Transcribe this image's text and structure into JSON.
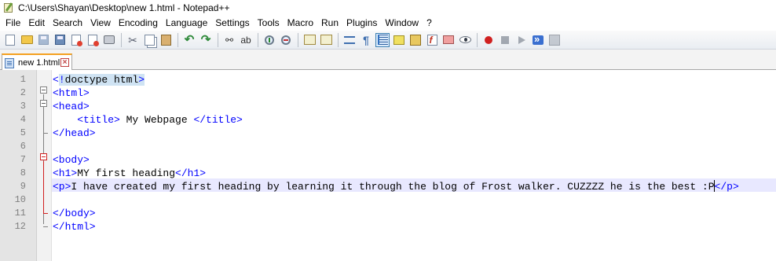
{
  "window": {
    "title": "C:\\Users\\Shayan\\Desktop\\new 1.html - Notepad++"
  },
  "menu": [
    "File",
    "Edit",
    "Search",
    "View",
    "Encoding",
    "Language",
    "Settings",
    "Tools",
    "Macro",
    "Run",
    "Plugins",
    "Window",
    "?"
  ],
  "toolbar": {
    "icons": [
      "new-file",
      "open-file",
      "save",
      "save-all",
      "close",
      "close-all",
      "print",
      "cut",
      "copy",
      "paste",
      "undo",
      "redo",
      "find",
      "replace",
      "zoom-in",
      "zoom-out",
      "sync-vertical",
      "sync-horizontal",
      "word-wrap",
      "show-all-chars",
      "indent-guide",
      "user-language",
      "document-map",
      "function-list",
      "folder-workspace",
      "monitoring",
      "record-macro",
      "stop-recording",
      "playback-macro",
      "run-macro-multiple",
      "save-macro"
    ]
  },
  "tabs": [
    {
      "label": "new 1.html",
      "active": true
    }
  ],
  "editor": {
    "current_line": 9,
    "lines": [
      {
        "n": "1",
        "tokens": [
          {
            "t": "tag",
            "v": "<"
          },
          {
            "t": "tag-bg",
            "v": "!"
          },
          {
            "t": "txt-bg",
            "v": "doctype html"
          },
          {
            "t": "tag-bg",
            "v": ">"
          }
        ]
      },
      {
        "n": "2",
        "tokens": [
          {
            "t": "tag",
            "v": "<html>"
          }
        ]
      },
      {
        "n": "3",
        "tokens": [
          {
            "t": "tag",
            "v": "<head>"
          }
        ]
      },
      {
        "n": "4",
        "tokens": [
          {
            "t": "txt",
            "v": "    "
          },
          {
            "t": "tag",
            "v": "<title>"
          },
          {
            "t": "txt",
            "v": " My Webpage "
          },
          {
            "t": "tag",
            "v": "</title>"
          }
        ]
      },
      {
        "n": "5",
        "tokens": [
          {
            "t": "tag",
            "v": "</head>"
          }
        ]
      },
      {
        "n": "6",
        "tokens": []
      },
      {
        "n": "7",
        "tokens": [
          {
            "t": "tag",
            "v": "<body>"
          }
        ]
      },
      {
        "n": "8",
        "tokens": [
          {
            "t": "tag",
            "v": "<h1>"
          },
          {
            "t": "txt",
            "v": "MY first heading"
          },
          {
            "t": "tag",
            "v": "</h1>"
          }
        ]
      },
      {
        "n": "9",
        "tokens": [
          {
            "t": "tag",
            "v": "<p>"
          },
          {
            "t": "txt",
            "v": "I have created my first heading by learning it through the blog of Frost walker. CUZZZZ he is the best :P"
          },
          {
            "t": "caret",
            "v": ""
          },
          {
            "t": "tag",
            "v": "</p>"
          }
        ]
      },
      {
        "n": "10",
        "tokens": []
      },
      {
        "n": "11",
        "tokens": [
          {
            "t": "tag",
            "v": "</body>"
          }
        ]
      },
      {
        "n": "12",
        "tokens": [
          {
            "t": "tag",
            "v": "</html>"
          }
        ]
      }
    ]
  }
}
